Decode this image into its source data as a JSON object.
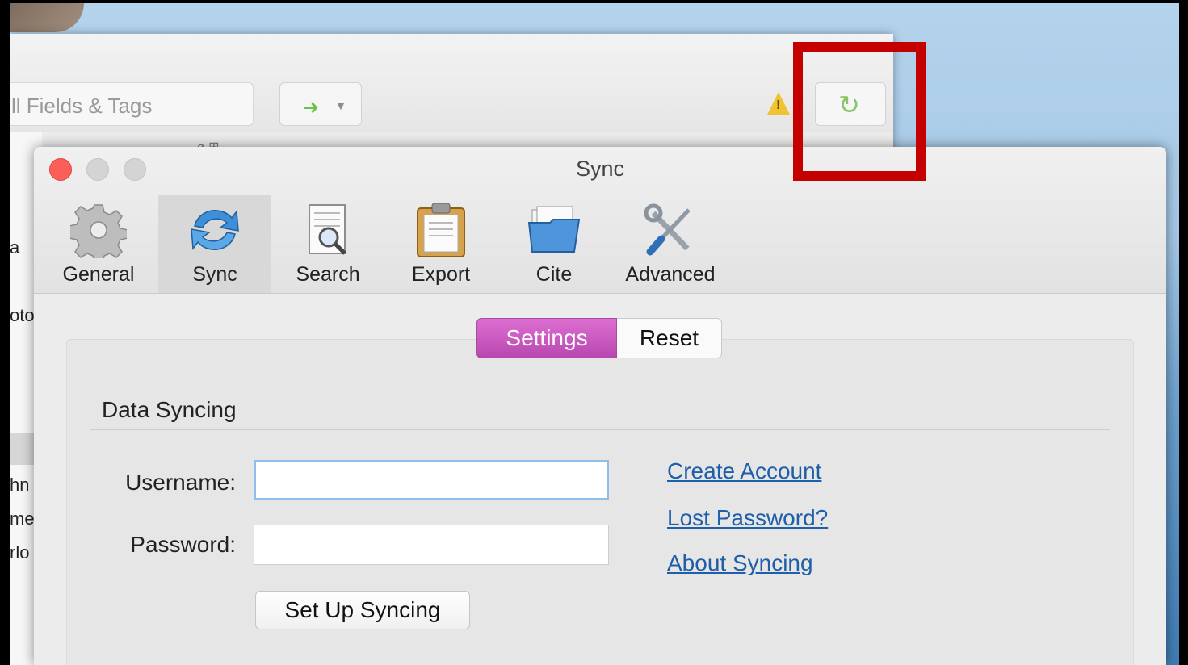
{
  "main_window": {
    "search_text": "ll Fields & Tags",
    "nav_arrow": "➜",
    "nav_caret": "▼",
    "warn_symbol": "!",
    "sync_symbol": "↻",
    "column_icons": "⌀ ⊞",
    "list_rows": [
      "a",
      "oto",
      "hn",
      "me",
      "rlo"
    ]
  },
  "prefs": {
    "title": "Sync",
    "tabs": [
      {
        "label": "General",
        "icon": "gear-icon"
      },
      {
        "label": "Sync",
        "icon": "sync-icon"
      },
      {
        "label": "Search",
        "icon": "search-document-icon"
      },
      {
        "label": "Export",
        "icon": "clipboard-icon"
      },
      {
        "label": "Cite",
        "icon": "folder-icon"
      },
      {
        "label": "Advanced",
        "icon": "tools-icon"
      }
    ],
    "segments": {
      "settings": "Settings",
      "reset": "Reset"
    },
    "section_title": "Data Syncing",
    "username_label": "Username:",
    "password_label": "Password:",
    "username_value": "",
    "password_value": "",
    "setup_button": "Set Up Syncing",
    "links": {
      "create_account": "Create Account",
      "lost_password": "Lost Password?",
      "about_syncing": "About Syncing"
    }
  },
  "colors": {
    "annotation": "#c40000",
    "segment_active": "#c656bf",
    "link": "#1f5ea8"
  }
}
